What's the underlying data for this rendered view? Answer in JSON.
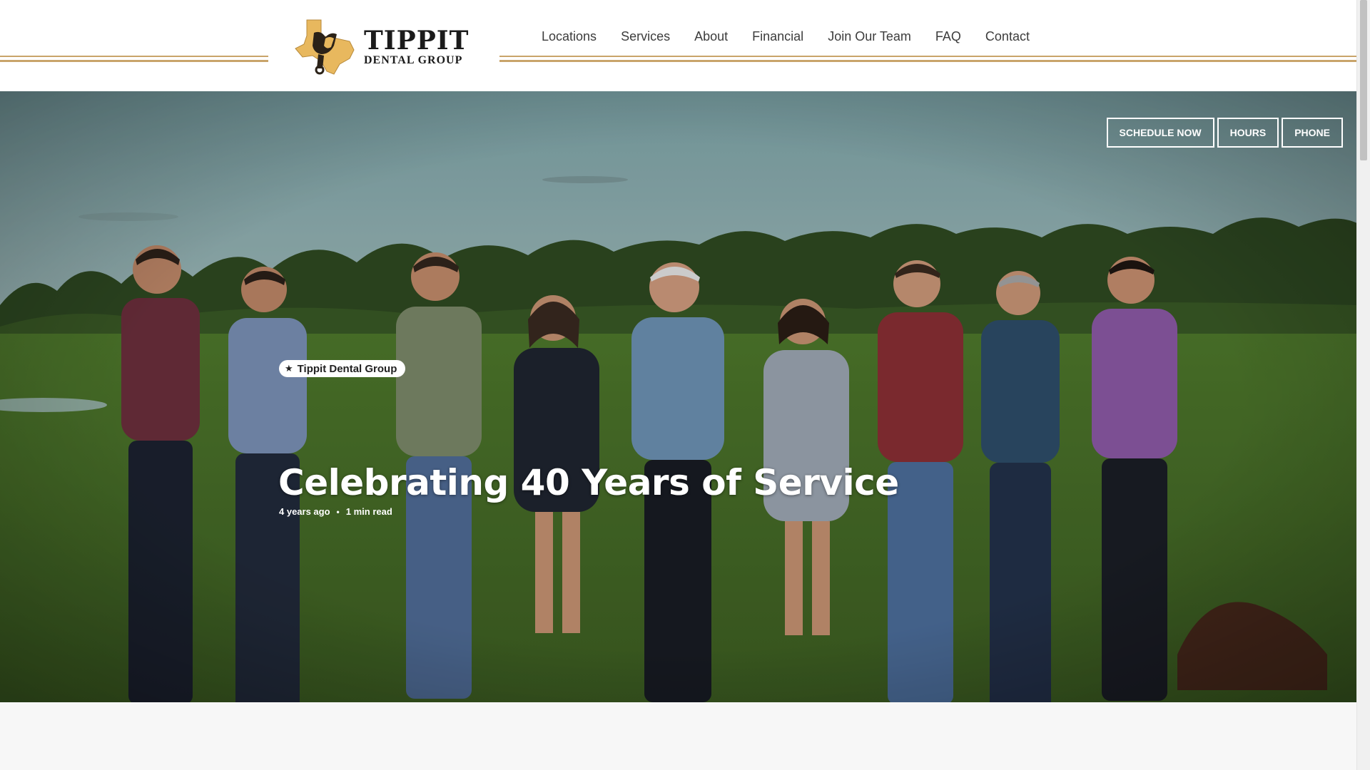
{
  "brand": {
    "name": "TIPPIT",
    "subtitle": "DENTAL GROUP",
    "accent_color": "#c9a46a",
    "logo_icon": "saddle-texas-logo-icon"
  },
  "nav": {
    "items": [
      "Locations",
      "Services",
      "About",
      "Financial",
      "Join Our Team",
      "FAQ",
      "Contact"
    ]
  },
  "cta": {
    "schedule": "SCHEDULE NOW",
    "hours": "HOURS",
    "phone": "PHONE"
  },
  "post": {
    "category": "Tippit Dental Group",
    "category_icon": "star-icon",
    "title": "Celebrating 40 Years of Service",
    "age": "4 years ago",
    "separator": "•",
    "read_time": "1 min read"
  },
  "hero_image": {
    "description_icon": "team-photo"
  }
}
